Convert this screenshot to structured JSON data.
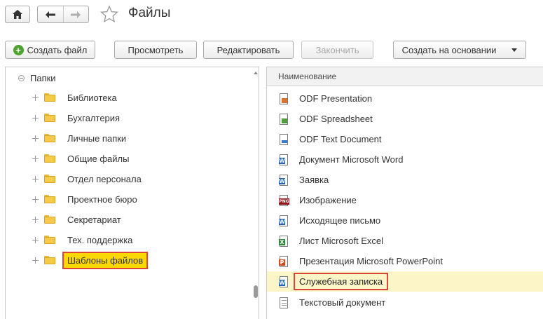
{
  "window": {
    "title": "Файлы"
  },
  "toolbar": {
    "create_file": "Создать файл",
    "view": "Просмотреть",
    "edit": "Редактировать",
    "finish": "Закончить",
    "create_based_on": "Создать на основании"
  },
  "folders": {
    "root": "Папки",
    "items": [
      {
        "label": "Библиотека"
      },
      {
        "label": "Бухгалтерия"
      },
      {
        "label": "Личные папки"
      },
      {
        "label": "Общие файлы"
      },
      {
        "label": "Отдел персонала"
      },
      {
        "label": "Проектное бюро"
      },
      {
        "label": "Секретариат"
      },
      {
        "label": "Тех. поддержка"
      },
      {
        "label": "Шаблоны файлов",
        "selected": true
      }
    ]
  },
  "files": {
    "column_header": "Наименование",
    "rows": [
      {
        "name": "ODF Presentation",
        "icon": "odf-presentation-icon"
      },
      {
        "name": "ODF Spreadsheet",
        "icon": "odf-spreadsheet-icon"
      },
      {
        "name": "ODF Text Document",
        "icon": "odf-text-icon"
      },
      {
        "name": "Документ Microsoft Word",
        "icon": "word-icon"
      },
      {
        "name": "Заявка",
        "icon": "word-icon"
      },
      {
        "name": "Изображение",
        "icon": "png-icon"
      },
      {
        "name": "Исходящее письмо",
        "icon": "word-icon"
      },
      {
        "name": "Лист Microsoft Excel",
        "icon": "excel-icon"
      },
      {
        "name": "Презентация Microsoft PowerPoint",
        "icon": "powerpoint-icon"
      },
      {
        "name": "Служебная записка",
        "icon": "word-icon",
        "selected": true
      },
      {
        "name": "Текстовый документ",
        "icon": "text-icon"
      }
    ]
  },
  "colors": {
    "selection_fill": "#fcd700",
    "selection_border": "#d9453a",
    "row_selected_bg": "#fbf5c8",
    "folder": "#f7c948"
  }
}
